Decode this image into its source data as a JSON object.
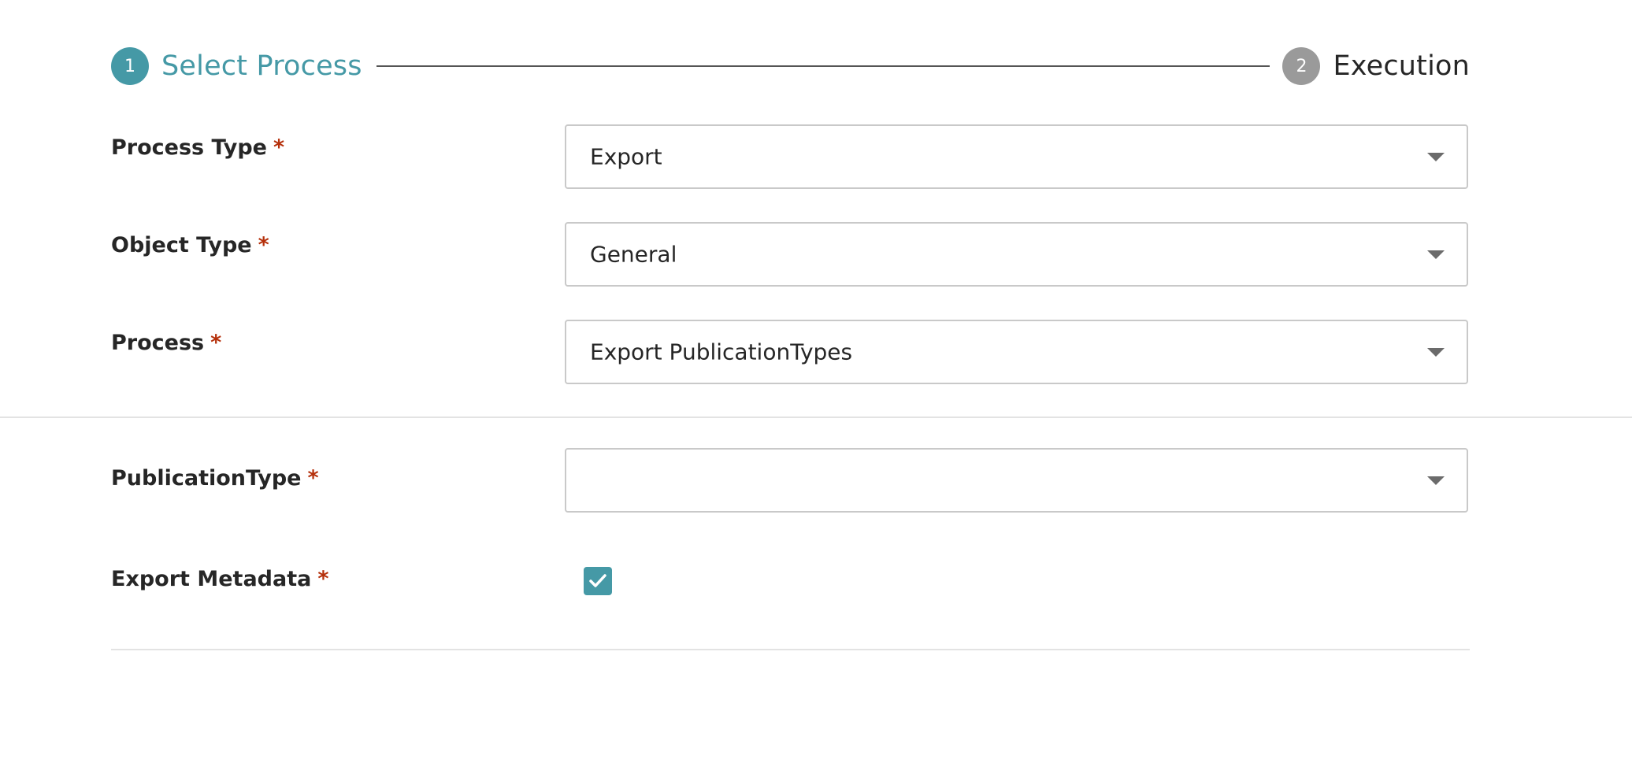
{
  "stepper": {
    "steps": [
      {
        "number": "1",
        "label": "Select Process",
        "state": "active"
      },
      {
        "number": "2",
        "label": "Execution",
        "state": "inactive"
      }
    ]
  },
  "form": {
    "required_marker": "*",
    "process_type": {
      "label": "Process Type",
      "value": "Export"
    },
    "object_type": {
      "label": "Object Type",
      "value": "General"
    },
    "process": {
      "label": "Process",
      "value": "Export PublicationTypes"
    },
    "publication_type": {
      "label": "PublicationType",
      "value": ""
    },
    "export_metadata": {
      "label": "Export Metadata",
      "checked": true
    }
  },
  "colors": {
    "accent": "#4599a6",
    "inactive_step": "#9a9a9a",
    "required": "#b5300b",
    "text": "#262626"
  },
  "icons": {
    "dropdown": "caret-down-icon",
    "checkbox": "checkmark-icon"
  }
}
